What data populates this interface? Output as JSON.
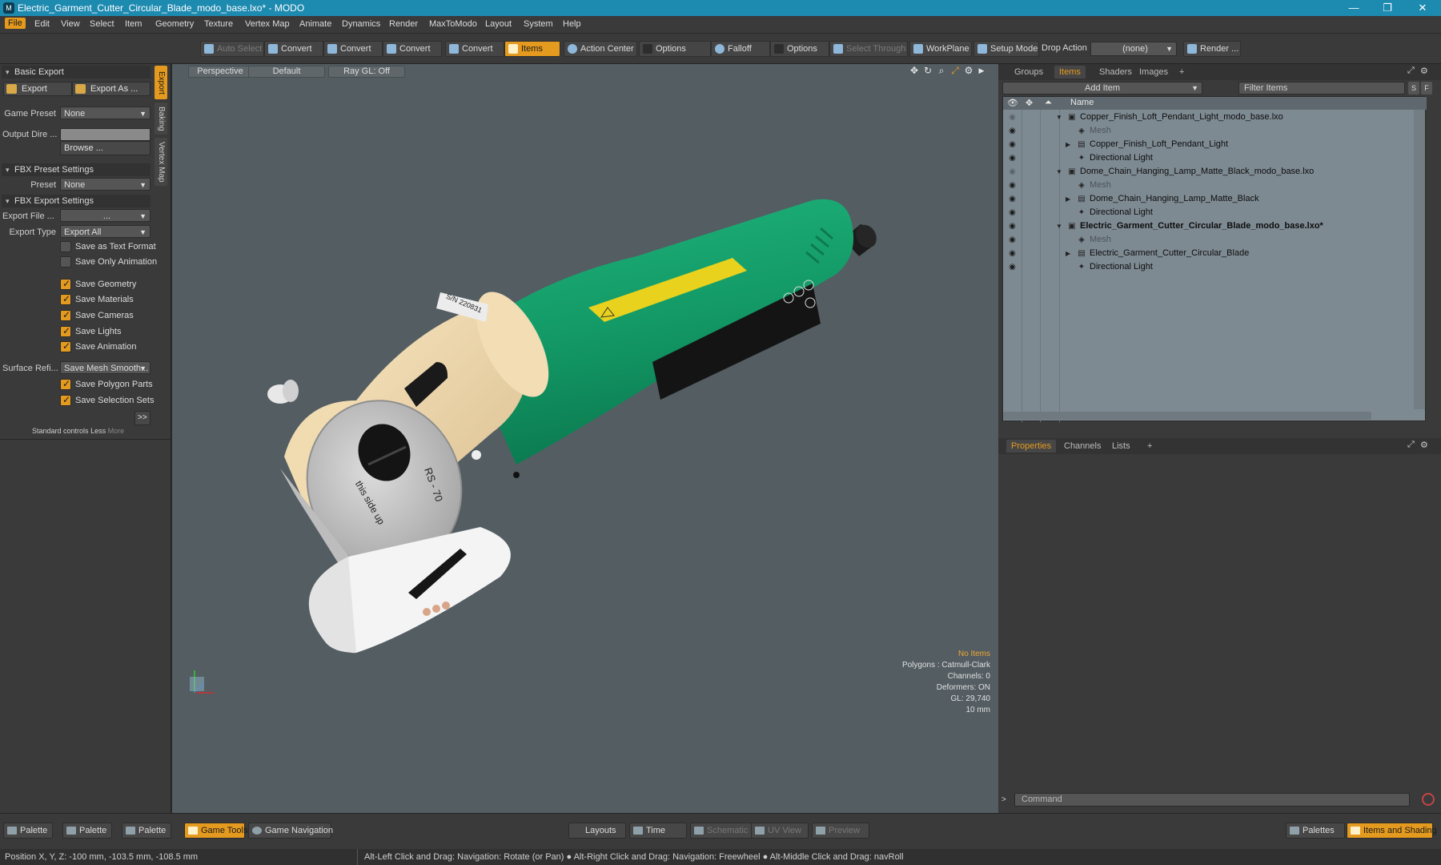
{
  "window": {
    "title": "Electric_Garment_Cutter_Circular_Blade_modo_base.lxo* - MODO",
    "app_icon": "modo-logo-icon"
  },
  "menubar": [
    "File",
    "Edit",
    "View",
    "Select",
    "Item",
    "Geometry",
    "Texture",
    "Vertex Map",
    "Animate",
    "Dynamics",
    "Render",
    "MaxToModo",
    "Layout",
    "System",
    "Help"
  ],
  "toolbar": {
    "auto_select": "Auto Select",
    "convert1": "Convert",
    "convert2": "Convert",
    "convert3": "Convert",
    "convert4": "Convert",
    "items": "Items",
    "action_center": "Action Center",
    "options1": "Options",
    "falloff": "Falloff",
    "options2": "Options",
    "select_through": "Select Through",
    "workplane": "WorkPlane",
    "setup_mode": "Setup Mode",
    "drop_action": "Drop Action",
    "drop_value": "(none)",
    "render": "Render ..."
  },
  "left_panel": {
    "basic_export": "Basic Export",
    "export": "Export",
    "export_as": "Export As ...",
    "game_preset_label": "Game Preset",
    "game_preset_value": "None",
    "output_dir_label": "Output Dire ...",
    "browse": "Browse ...",
    "fbx_preset": "FBX Preset Settings",
    "preset_label": "Preset",
    "preset_value": "None",
    "fbx_export": "FBX Export Settings",
    "export_file_label": "Export File ...",
    "export_file_value": "...",
    "export_type_label": "Export Type",
    "export_type_value": "Export All",
    "checks": [
      {
        "label": "Save as Text Format",
        "on": false
      },
      {
        "label": "Save Only Animation",
        "on": false
      },
      {
        "label": "Save Geometry",
        "on": true
      },
      {
        "label": "Save Materials",
        "on": true
      },
      {
        "label": "Save Cameras",
        "on": true
      },
      {
        "label": "Save Lights",
        "on": true
      },
      {
        "label": "Save Animation",
        "on": true
      }
    ],
    "surface_label": "Surface Refi...",
    "surface_value": "Save Mesh Smooth...",
    "checks2": [
      {
        "label": "Save Polygon Parts",
        "on": true
      },
      {
        "label": "Save Selection Sets",
        "on": true
      }
    ],
    "more_btn": ">>",
    "standard_controls": "Standard controls",
    "less": "Less",
    "more": "More",
    "side_tabs": [
      "Export",
      "Baking",
      "Vertex Map"
    ]
  },
  "viewport": {
    "tabs": [
      "Perspective",
      "Default",
      "Ray GL: Off"
    ],
    "info": {
      "no_items": "No Items",
      "polygons": "Polygons : Catmull-Clark",
      "channels": "Channels: 0",
      "deformers": "Deformers: ON",
      "gl": "GL: 29,740",
      "scale": "10 mm"
    },
    "model_text": {
      "blade": "RS - 70",
      "side": "this side up",
      "serial": "S/N 220831"
    }
  },
  "right_panel": {
    "top_tabs": [
      "Groups",
      "Items",
      "Shaders",
      "Images",
      "+"
    ],
    "add_item": "Add Item",
    "filter_items": "Filter Items",
    "col_name": "Name",
    "rows": [
      {
        "label": "Copper_Finish_Loft_Pendant_Light_modo_base.lxo",
        "level": 0,
        "kind": "scene",
        "dim": false,
        "bold": false,
        "expanded": true
      },
      {
        "label": "Mesh",
        "level": 1,
        "kind": "mesh",
        "dim": true,
        "bold": false,
        "expanded": false
      },
      {
        "label": "Copper_Finish_Loft_Pendant_Light",
        "level": 1,
        "kind": "group",
        "dim": false,
        "bold": false,
        "expanded": false
      },
      {
        "label": "Directional Light",
        "level": 1,
        "kind": "light",
        "dim": false,
        "bold": false,
        "expanded": false
      },
      {
        "label": "Dome_Chain_Hanging_Lamp_Matte_Black_modo_base.lxo",
        "level": 0,
        "kind": "scene",
        "dim": false,
        "bold": false,
        "expanded": true
      },
      {
        "label": "Mesh",
        "level": 1,
        "kind": "mesh",
        "dim": true,
        "bold": false,
        "expanded": false
      },
      {
        "label": "Dome_Chain_Hanging_Lamp_Matte_Black",
        "level": 1,
        "kind": "group",
        "dim": false,
        "bold": false,
        "expanded": false
      },
      {
        "label": "Directional Light",
        "level": 1,
        "kind": "light",
        "dim": false,
        "bold": false,
        "expanded": false
      },
      {
        "label": "Electric_Garment_Cutter_Circular_Blade_modo_base.lxo*",
        "level": 0,
        "kind": "scene",
        "dim": false,
        "bold": true,
        "expanded": true
      },
      {
        "label": "Mesh",
        "level": 1,
        "kind": "mesh",
        "dim": true,
        "bold": false,
        "expanded": false
      },
      {
        "label": "Electric_Garment_Cutter_Circular_Blade",
        "level": 1,
        "kind": "group",
        "dim": false,
        "bold": false,
        "expanded": false
      },
      {
        "label": "Directional Light",
        "level": 1,
        "kind": "light",
        "dim": false,
        "bold": false,
        "expanded": false
      }
    ],
    "bottom_tabs": [
      "Properties",
      "Channels",
      "Lists",
      "+"
    ],
    "command_placeholder": "Command"
  },
  "bottom_bar": {
    "palette1": "Palette",
    "palette2": "Palette",
    "palette3": "Palette",
    "game_tools": "Game Tools",
    "game_navigation": "Game Navigation",
    "layouts": "Layouts",
    "time": "Time",
    "schematic": "Schematic",
    "uv_view": "UV View",
    "preview": "Preview",
    "palettes": "Palettes",
    "items_shading": "Items and Shading"
  },
  "status": {
    "position": "Position X, Y, Z:  -100 mm, -103.5 mm, -108.5 mm",
    "hint": "Alt-Left Click and Drag: Navigation: Rotate (or Pan) ● Alt-Right Click and Drag: Navigation: Freewheel ● Alt-Middle Click and Drag: navRoll"
  },
  "colors": {
    "accent": "#e49a1e",
    "titlebar": "#1d8ab0",
    "viewport_bg": "#535d62",
    "item_list_bg": "#7e8a92",
    "body_green": "#16a06c"
  }
}
